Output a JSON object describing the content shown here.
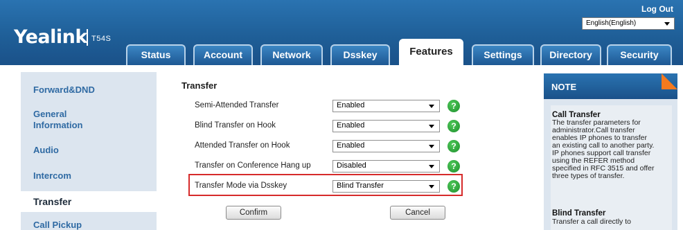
{
  "header": {
    "logo": "Yealink",
    "model": "T54S",
    "logout": "Log Out",
    "language": "English(English)"
  },
  "tabs": [
    "Status",
    "Account",
    "Network",
    "Dsskey",
    "Features",
    "Settings",
    "Directory",
    "Security"
  ],
  "nav": [
    "Forward&DND",
    "General Information",
    "Audio",
    "Intercom",
    "Transfer",
    "Call Pickup"
  ],
  "content": {
    "section_title": "Transfer",
    "rows": [
      {
        "label": "Semi-Attended Transfer",
        "value": "Enabled"
      },
      {
        "label": "Blind Transfer on Hook",
        "value": "Enabled"
      },
      {
        "label": "Attended Transfer on Hook",
        "value": "Enabled"
      },
      {
        "label": "Transfer on Conference Hang up",
        "value": "Disabled"
      },
      {
        "label": "Transfer Mode via Dsskey",
        "value": "Blind Transfer"
      }
    ],
    "help_glyph": "?",
    "confirm": "Confirm",
    "cancel": "Cancel"
  },
  "note": {
    "header": "NOTE",
    "call_transfer_title": "Call Transfer",
    "call_transfer_lines": [
      "The transfer parameters for",
      "administrator.Call transfer",
      "enables IP phones to transfer",
      "an existing call to another party.",
      "IP phones support call transfer",
      "using the REFER method",
      "specified in RFC 3515 and offer",
      "three types of transfer."
    ],
    "blind_transfer_title": "Blind Transfer",
    "blind_transfer_lines": [
      "Transfer a call directly to"
    ]
  },
  "colors": {
    "header_blue": "#1f5f98",
    "nav_bg": "#dce5ef",
    "highlight_red": "#d62a2a",
    "note_accent": "#f47a1f",
    "help_green": "#2aa338"
  }
}
